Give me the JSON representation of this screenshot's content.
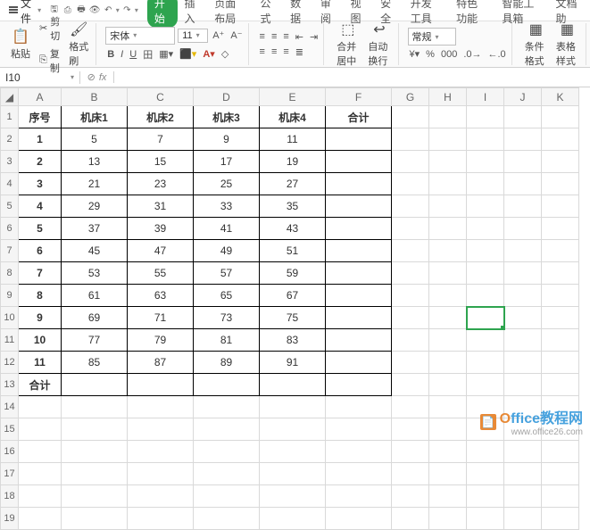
{
  "menu": {
    "file": "文件",
    "tabs": [
      "开始",
      "插入",
      "页面布局",
      "公式",
      "数据",
      "审阅",
      "视图",
      "安全",
      "开发工具",
      "特色功能",
      "智能工具箱",
      "文档助"
    ]
  },
  "ribbon": {
    "paste": "粘贴",
    "cut": "剪切",
    "copy": "复制",
    "format_painter": "格式刷",
    "font_name": "宋体",
    "font_size": "11",
    "merge_center": "合并居中",
    "auto_wrap": "自动换行",
    "number_format": "常规",
    "cond_format": "条件格式",
    "table_style": "表格样式"
  },
  "namebox": {
    "ref": "I10",
    "fx": "fx"
  },
  "columns": [
    "A",
    "B",
    "C",
    "D",
    "E",
    "F",
    "G",
    "H",
    "I",
    "J",
    "K"
  ],
  "chart_data": {
    "type": "table",
    "headers": [
      "序号",
      "机床1",
      "机床2",
      "机床3",
      "机床4",
      "合计"
    ],
    "rows": [
      [
        "1",
        "5",
        "7",
        "9",
        "11",
        ""
      ],
      [
        "2",
        "13",
        "15",
        "17",
        "19",
        ""
      ],
      [
        "3",
        "21",
        "23",
        "25",
        "27",
        ""
      ],
      [
        "4",
        "29",
        "31",
        "33",
        "35",
        ""
      ],
      [
        "5",
        "37",
        "39",
        "41",
        "43",
        ""
      ],
      [
        "6",
        "45",
        "47",
        "49",
        "51",
        ""
      ],
      [
        "7",
        "53",
        "55",
        "57",
        "59",
        ""
      ],
      [
        "8",
        "61",
        "63",
        "65",
        "67",
        ""
      ],
      [
        "9",
        "69",
        "71",
        "73",
        "75",
        ""
      ],
      [
        "10",
        "77",
        "79",
        "81",
        "83",
        ""
      ],
      [
        "11",
        "85",
        "87",
        "89",
        "91",
        ""
      ],
      [
        "合计",
        "",
        "",
        "",
        "",
        ""
      ]
    ]
  },
  "watermark": {
    "brand_o": "O",
    "brand_rest": "ffice教程网",
    "url": "www.office26.com"
  }
}
